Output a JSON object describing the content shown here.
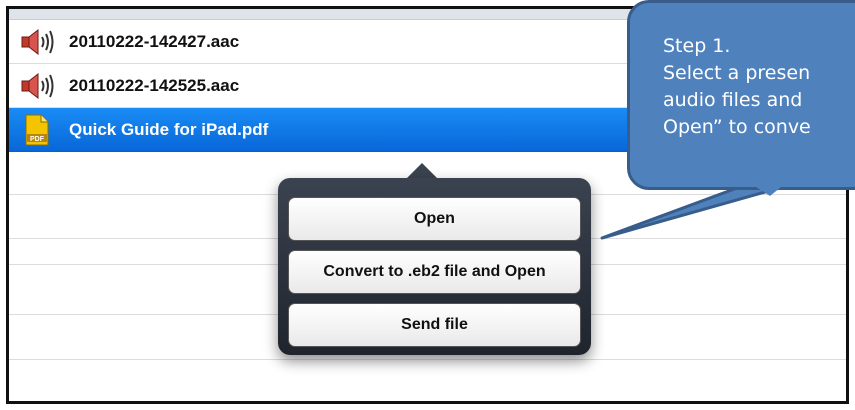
{
  "files": [
    {
      "name": "20110222-142427.aac",
      "icon": "speaker-icon",
      "selected": false
    },
    {
      "name": "20110222-142525.aac",
      "icon": "speaker-icon",
      "selected": false
    },
    {
      "name": "Quick Guide for iPad.pdf",
      "icon": "pdf-icon",
      "selected": true
    }
  ],
  "pdf_icon_text": "PDF",
  "popover": {
    "open_label": "Open",
    "convert_label": "Convert to .eb2 file and Open",
    "send_label": "Send file"
  },
  "callout": {
    "line1": "Step 1.",
    "line2": "Select a presen",
    "line3": "audio files and",
    "line4": "Open” to conve"
  },
  "colors": {
    "selection": "#1a8cf5",
    "callout_fill": "#4f81bd",
    "callout_border": "#385d8a"
  }
}
